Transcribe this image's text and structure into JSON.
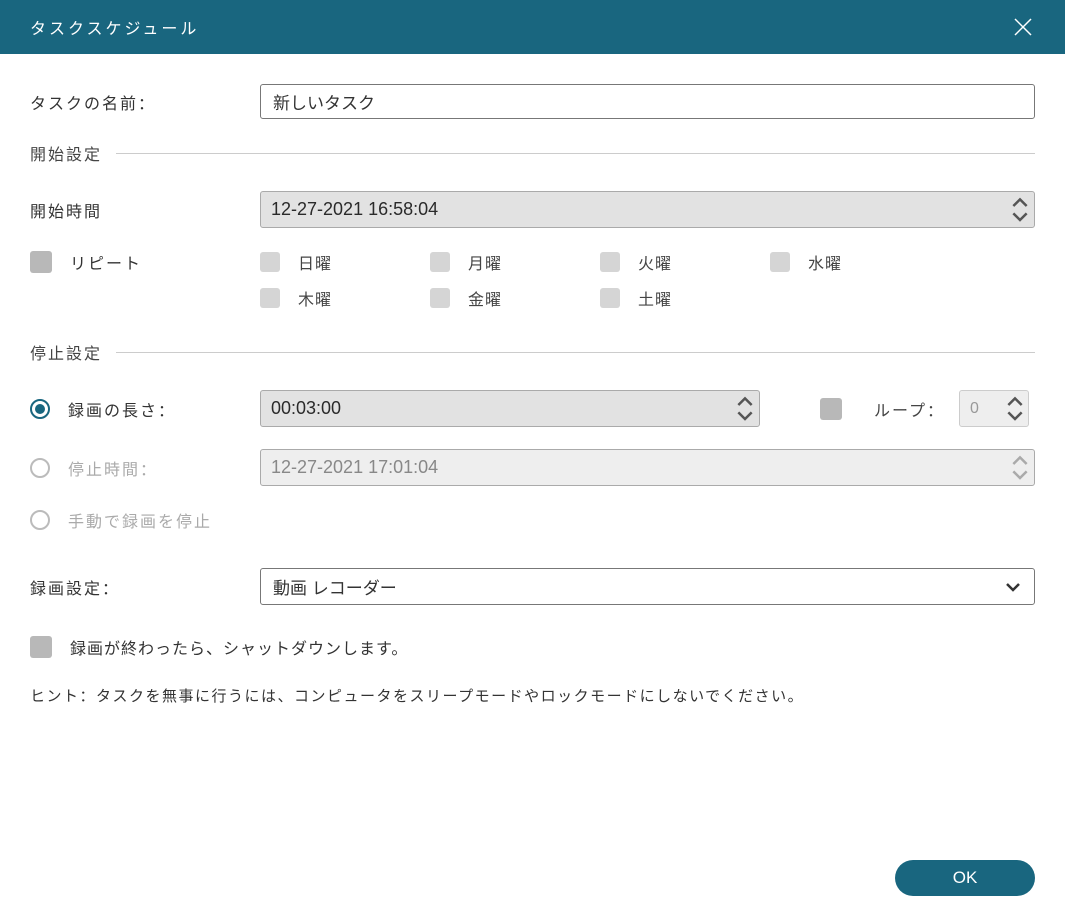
{
  "header": {
    "title": "タスクスケジュール"
  },
  "taskName": {
    "label": "タスクの名前：",
    "value": "新しいタスク"
  },
  "startSection": {
    "title": "開始設定"
  },
  "startTime": {
    "label": "開始時間",
    "value": "12-27-2021 16:58:04"
  },
  "repeat": {
    "label": "リピート",
    "days": [
      "日曜",
      "月曜",
      "火曜",
      "水曜",
      "木曜",
      "金曜",
      "土曜"
    ]
  },
  "stopSection": {
    "title": "停止設定"
  },
  "duration": {
    "label": "録画の長さ：",
    "value": "00:03:00"
  },
  "loop": {
    "label": "ループ：",
    "value": "0"
  },
  "stopTime": {
    "label": "停止時間：",
    "value": "12-27-2021 17:01:04"
  },
  "manualStop": {
    "label": "手動で録画を停止"
  },
  "recSetting": {
    "label": "録画設定：",
    "value": "動画 レコーダー"
  },
  "shutdown": {
    "label": "録画が終わったら、シャットダウンします。"
  },
  "hint": "ヒント：タスクを無事に行うには、コンピュータをスリープモードやロックモードにしないでください。",
  "ok": "OK"
}
